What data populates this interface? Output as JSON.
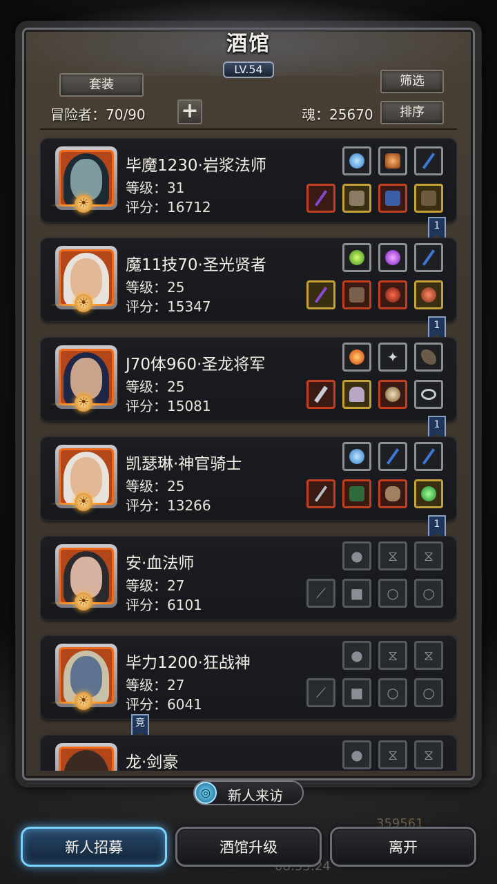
{
  "header": {
    "title": "酒馆",
    "level": "LV.54",
    "suit_label": "套装",
    "filter_label": "筛选",
    "sort_label": "排序",
    "adventurers": "冒险者：70/90",
    "soul": "魂：25670",
    "add_label": "+"
  },
  "adventurers": [
    {
      "name": "毕魔1230·岩浆法师",
      "level": "等级：31",
      "score": "评分：16712",
      "flag": "1"
    },
    {
      "name": "魔11技70·圣光贤者",
      "level": "等级：25",
      "score": "评分：15347",
      "flag": "1"
    },
    {
      "name": "J70体960·圣龙将军",
      "level": "等级：25",
      "score": "评分：15081",
      "flag": "1"
    },
    {
      "name": "凯瑟琳·神官骑士",
      "level": "等级：25",
      "score": "评分：13266",
      "flag": "1"
    },
    {
      "name": "安·血法师",
      "level": "等级：27",
      "score": "评分：6101",
      "flag": ""
    },
    {
      "name": "毕力1200·狂战神",
      "level": "等级：27",
      "score": "评分：6041",
      "flag": "竞"
    },
    {
      "name": "龙·剑豪",
      "level": "",
      "score": "",
      "flag": ""
    }
  ],
  "footer": {
    "visit_label": "新人来访",
    "recruit_label": "新人招募",
    "upgrade_label": "酒馆升级",
    "leave_label": "离开",
    "faint_money": "359561",
    "faint_time": "08:53:24"
  },
  "colors": {
    "frame": "#3f382f",
    "card": "#1b1d22",
    "portrait_border": "#f06b1c",
    "flag": "#1f3559",
    "recruit_glow": "#7ad2ff"
  }
}
